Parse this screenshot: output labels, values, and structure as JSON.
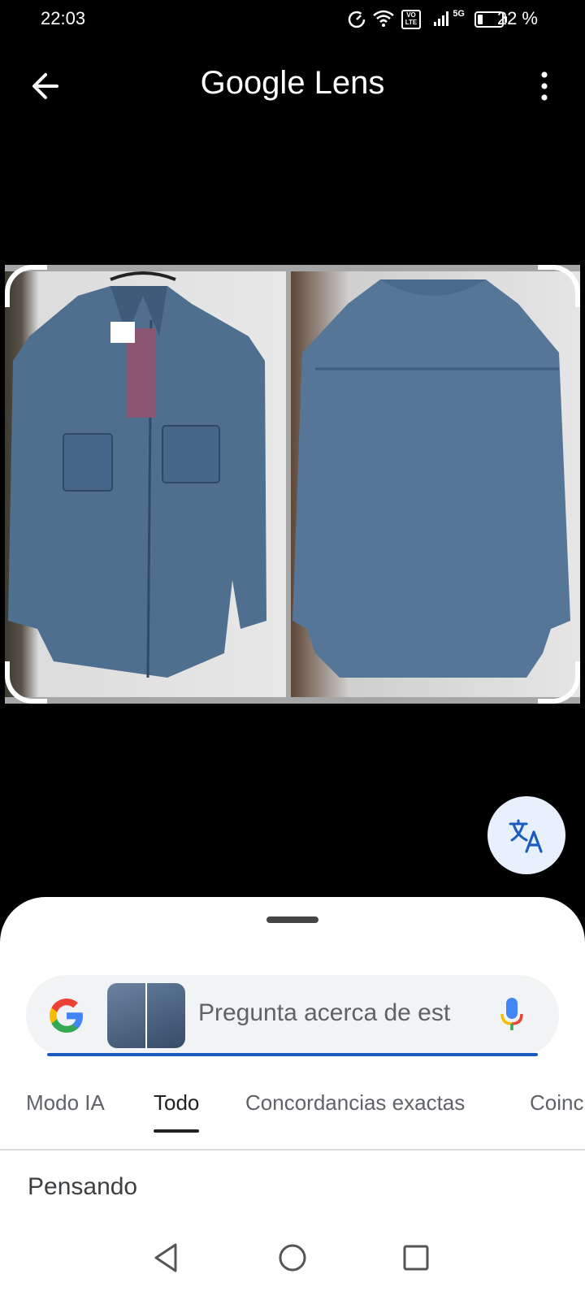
{
  "status_bar": {
    "time": "22:03",
    "battery_percent": "22 %",
    "battery_level": 0.22,
    "network_label": "5G",
    "volte_label": "VO LTE"
  },
  "header": {
    "title": "Google Lens",
    "back_icon": "arrow-left-icon",
    "menu_icon": "more-vert-icon"
  },
  "image_area": {
    "crop_handles": true
  },
  "fab": {
    "icon": "translate-icon"
  },
  "sheet": {
    "search": {
      "placeholder": "Pregunta acerca de est",
      "logo": "google-g-logo",
      "mic_icon": "mic-icon"
    },
    "tabs": [
      {
        "label": "Modo IA",
        "active": false
      },
      {
        "label": "Todo",
        "active": true
      },
      {
        "label": "Concordancias exactas",
        "active": false
      },
      {
        "label": "Coinc",
        "active": false
      }
    ],
    "status_text": "Pensando"
  },
  "nav_bar": {
    "back": "nav-back-icon",
    "home": "nav-home-icon",
    "recents": "nav-recents-icon"
  },
  "colors": {
    "accent": "#1a5dbf",
    "fab_bg": "#e8f0fe",
    "background": "#000000",
    "sheet": "#ffffff"
  }
}
